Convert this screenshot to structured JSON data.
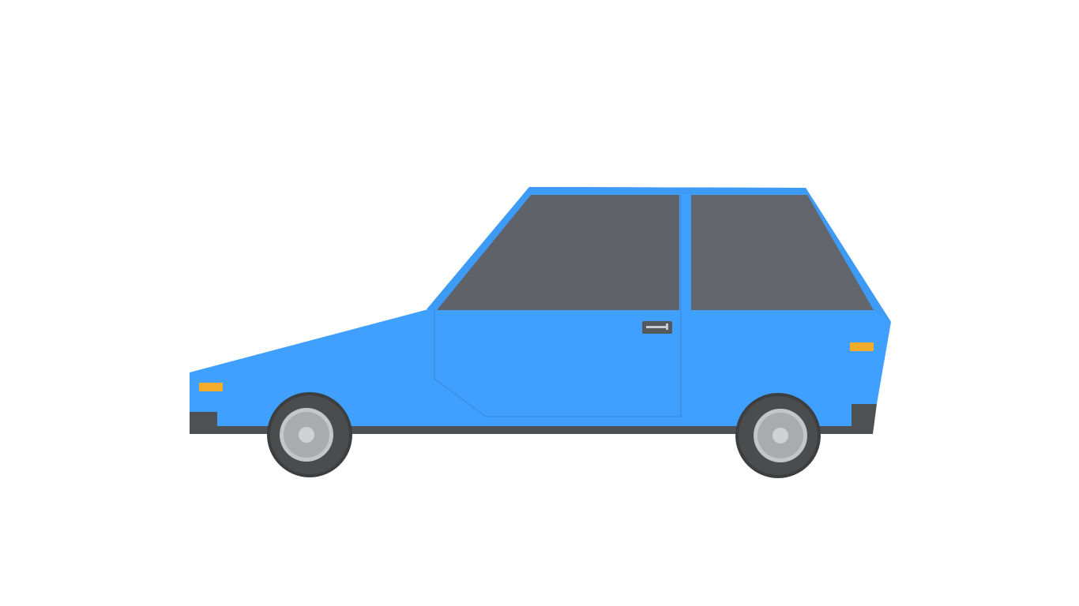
{
  "scene": {
    "background": "#ffffff",
    "subject": "car-side-view"
  },
  "colors": {
    "body_main": "#40a0ff",
    "body_light": "#43a2ff",
    "body_edge": "#3b96f0",
    "window_glass": "#5f6369",
    "window_glass_light": "#686c72",
    "bumper": "#4e5154",
    "indicator": "#f2ab2a",
    "handle": "#55595e",
    "handle_slot": "#c8ccd0",
    "tire": "#4a4c4e",
    "tire_shadow": "#3c3e40",
    "hubcap": "#a9abae",
    "hubcap_rim": "#c4c6c9",
    "hub_center": "#cfd1d4"
  },
  "icons": {
    "wheel": "wheel-icon",
    "door_handle": "door-handle-icon",
    "indicator_light": "indicator-light-icon"
  }
}
